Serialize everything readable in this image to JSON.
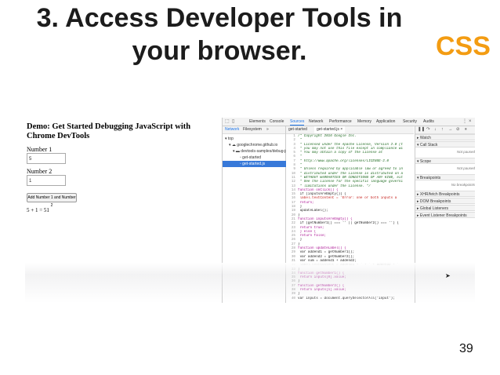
{
  "slide": {
    "title_line1": "3. Access Developer Tools in",
    "title_line2": "your browser.",
    "tag": "CSS",
    "page_number": "39"
  },
  "demo": {
    "title": "Demo: Get Started Debugging JavaScript with Chrome DevTools",
    "label1": "Number 1",
    "input1": "5",
    "label2": "Number 2",
    "input2": "1",
    "button": "Add Number 1 and Number 2",
    "result": "5 + 1 = 51"
  },
  "devtools": {
    "tabs": [
      "Elements",
      "Console",
      "Sources",
      "Network",
      "Performance",
      "Memory",
      "Application",
      "Security",
      "Audits"
    ],
    "active_tab": "Sources",
    "navigator_tabs": [
      "Network",
      "Filesystem",
      "»"
    ],
    "tree": [
      "top",
      "googlechrome.github.io",
      "devtools-samples/debug-js",
      "get-started",
      "get-started.js"
    ],
    "editor_tabs": [
      "get-started",
      "get-started.js ×"
    ],
    "code_lines": [
      {
        "n": "1",
        "t": "/* Copyright 2016 Google Inc.",
        "k": "com"
      },
      {
        "n": "2",
        "t": " *",
        "k": "com"
      },
      {
        "n": "3",
        "t": " * Licensed under the Apache License, Version 2.0 (t",
        "k": "com"
      },
      {
        "n": "4",
        "t": " * you may not use this file except in compliance wi",
        "k": "com"
      },
      {
        "n": "5",
        "t": " * You may obtain a copy of the License at",
        "k": "com"
      },
      {
        "n": "6",
        "t": " *",
        "k": "com"
      },
      {
        "n": "7",
        "t": " * http://www.apache.org/licenses/LICENSE-2.0",
        "k": "com"
      },
      {
        "n": "8",
        "t": " *",
        "k": "com"
      },
      {
        "n": "9",
        "t": " * Unless required by applicable law or agreed to in",
        "k": "com"
      },
      {
        "n": "10",
        "t": " * distributed under the License is distributed on a",
        "k": "com"
      },
      {
        "n": "11",
        "t": " * WITHOUT WARRANTIES OR CONDITIONS OF ANY KIND, eit",
        "k": "com"
      },
      {
        "n": "12",
        "t": " * See the License for the specific language governi",
        "k": "com"
      },
      {
        "n": "13",
        "t": " * limitations under the License. */",
        "k": "com"
      },
      {
        "n": "14",
        "t": "function onClick() {",
        "k": "kw"
      },
      {
        "n": "15",
        "t": "  if (inputsAreEmpty()) {",
        "k": "plain"
      },
      {
        "n": "16",
        "t": "    label.textContent = 'Error: one or both inputs a",
        "k": "str"
      },
      {
        "n": "17",
        "t": "    return;",
        "k": "kw"
      },
      {
        "n": "18",
        "t": "  }",
        "k": "plain"
      },
      {
        "n": "19",
        "t": "  updateLabel();",
        "k": "plain"
      },
      {
        "n": "20",
        "t": "}",
        "k": "plain"
      },
      {
        "n": "21",
        "t": "function inputsAreEmpty() {",
        "k": "kw"
      },
      {
        "n": "22",
        "t": "  if (getNumber1() === '' || getNumber2() === '') {",
        "k": "plain"
      },
      {
        "n": "23",
        "t": "    return true;",
        "k": "kw"
      },
      {
        "n": "24",
        "t": "  } else {",
        "k": "kw"
      },
      {
        "n": "25",
        "t": "    return false;",
        "k": "kw"
      },
      {
        "n": "26",
        "t": "  }",
        "k": "plain"
      },
      {
        "n": "27",
        "t": "}",
        "k": "plain"
      },
      {
        "n": "28",
        "t": "function updateLabel() {",
        "k": "kw"
      },
      {
        "n": "29",
        "t": "  var addend1 = getNumber1();",
        "k": "plain"
      },
      {
        "n": "30",
        "t": "  var addend2 = getNumber2();",
        "k": "plain"
      },
      {
        "n": "31",
        "t": "  var sum = addend1 + addend2;",
        "k": "plain"
      },
      {
        "n": "32",
        "t": "  label.textContent = addend1 + ' + ' + addend2 + '",
        "k": "plain"
      },
      {
        "n": "33",
        "t": "}",
        "k": "plain"
      },
      {
        "n": "34",
        "t": "function getNumber1() {",
        "k": "kw"
      },
      {
        "n": "35",
        "t": "  return inputs[0].value;",
        "k": "kw"
      },
      {
        "n": "36",
        "t": "}",
        "k": "plain"
      },
      {
        "n": "37",
        "t": "function getNumber2() {",
        "k": "kw"
      },
      {
        "n": "38",
        "t": "  return inputs[1].value;",
        "k": "kw"
      },
      {
        "n": "39",
        "t": "}",
        "k": "plain"
      },
      {
        "n": "40",
        "t": "var inputs = document.querySelectorAll('input');",
        "k": "plain"
      }
    ],
    "side_panes": [
      {
        "label": "▸ Watch",
        "note": ""
      },
      {
        "label": "▾ Call Stack",
        "note": "Not paused"
      },
      {
        "label": "▾ Scope",
        "note": "Not paused"
      },
      {
        "label": "▾ Breakpoints",
        "note": "No breakpoints"
      },
      {
        "label": "▸ XHR/fetch Breakpoints",
        "note": ""
      },
      {
        "label": "▸ DOM Breakpoints",
        "note": ""
      },
      {
        "label": "▸ Global Listeners",
        "note": ""
      },
      {
        "label": "▸ Event Listener Breakpoints",
        "note": ""
      }
    ]
  },
  "colors": {
    "tag": "#f39c12",
    "selection": "#3879d9",
    "accent": "#1a73e8"
  }
}
